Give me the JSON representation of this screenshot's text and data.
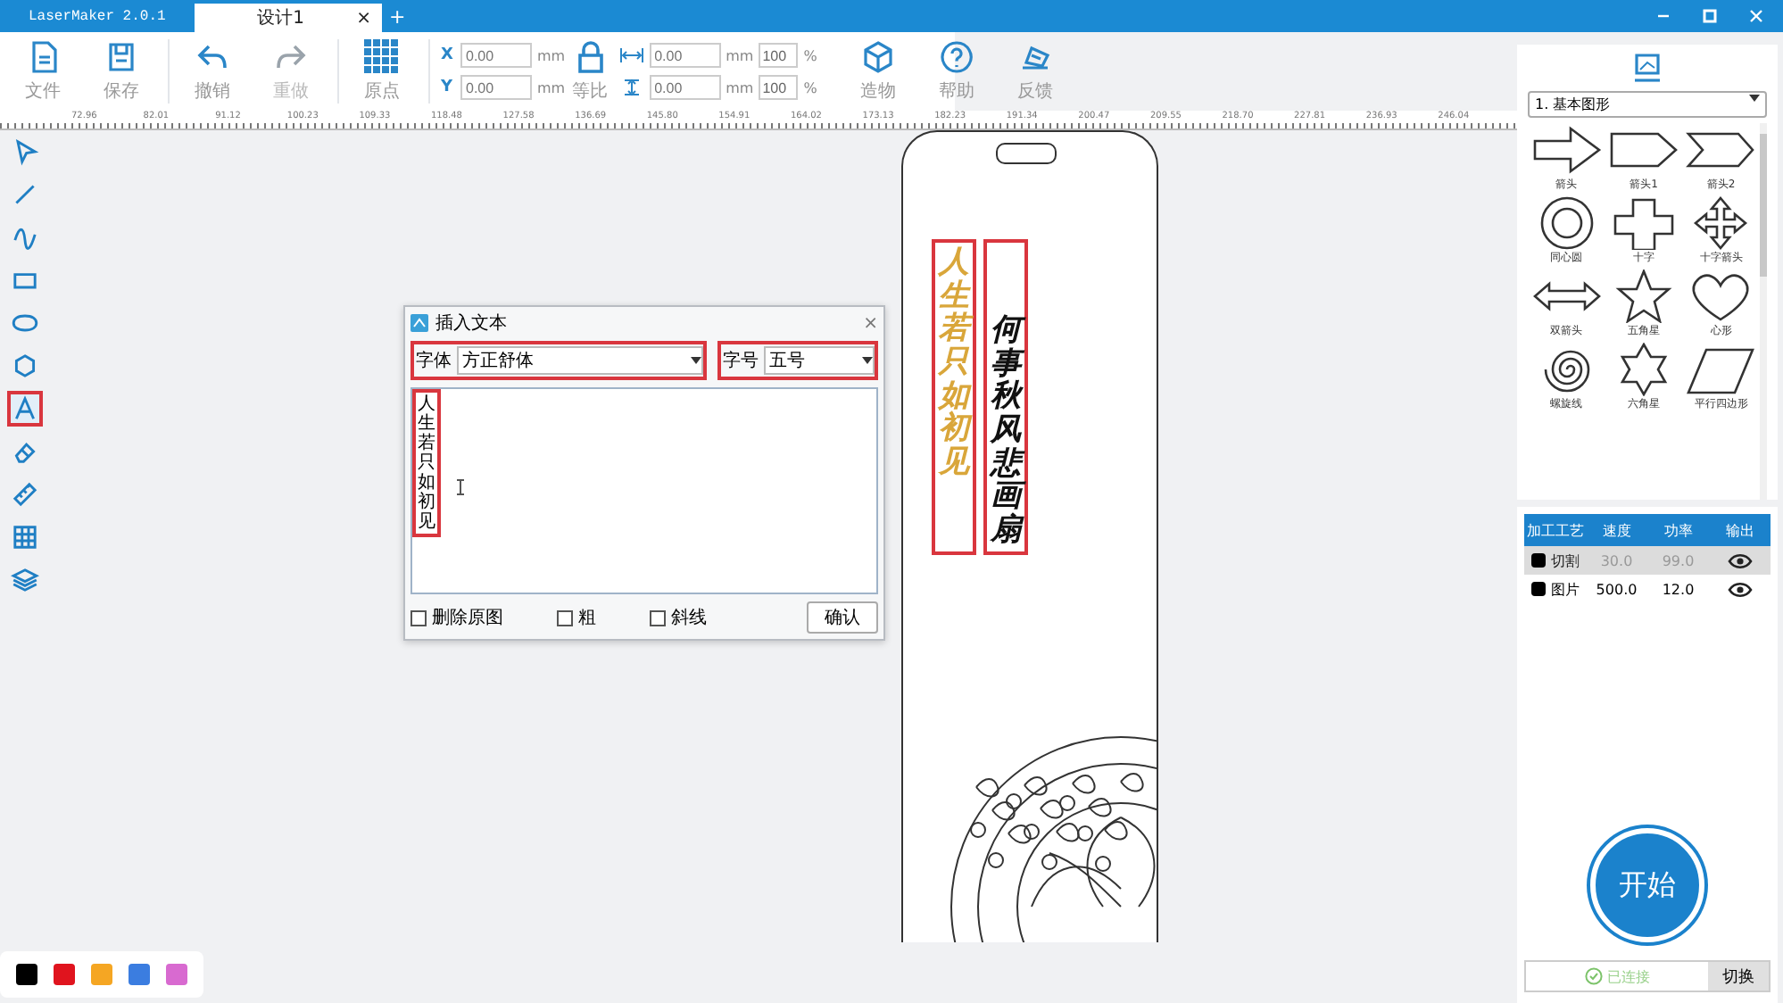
{
  "window": {
    "app_title": "LaserMaker 2.0.1",
    "tabs": [
      {
        "label": "设计1",
        "selected": true,
        "close": "×"
      }
    ],
    "new_tab": "+"
  },
  "toolbar": {
    "file_buttons": [
      {
        "label": "文件"
      },
      {
        "label": "保存"
      }
    ],
    "edit_buttons": [
      {
        "label": "撤销",
        "disabled": false
      },
      {
        "label": "重做",
        "disabled": true
      }
    ],
    "origin_button": "原点",
    "position": [
      {
        "axis": "X",
        "placeholder": "0.00",
        "unit": "mm"
      },
      {
        "axis": "Y",
        "placeholder": "0.00",
        "unit": "mm"
      }
    ],
    "lock_button": "等比",
    "size": [
      {
        "placeholder": "0.00",
        "unit": "mm",
        "percent": "100",
        "percent_unit": "%"
      },
      {
        "placeholder": "0.00",
        "unit": "mm",
        "percent": "100",
        "percent_unit": "%"
      }
    ],
    "help_buttons": [
      {
        "label": "造物"
      },
      {
        "label": "帮助"
      },
      {
        "label": "反馈"
      }
    ]
  },
  "ruler": {
    "labels": [
      "72.96",
      "82.01",
      "91.12",
      "100.23",
      "109.33",
      "118.48",
      "127.58",
      "136.69",
      "145.80",
      "154.91",
      "164.02",
      "173.13",
      "182.23",
      "191.34",
      "200.47",
      "209.55",
      "218.70",
      "227.81",
      "236.93",
      "246.04"
    ]
  },
  "tools": [
    {
      "selected": false,
      "highlighted": false
    },
    {
      "selected": false,
      "highlighted": false
    },
    {
      "selected": false,
      "highlighted": false
    },
    {
      "selected": false,
      "highlighted": false
    },
    {
      "selected": false,
      "highlighted": false
    },
    {
      "selected": false,
      "highlighted": false
    },
    {
      "selected": true,
      "highlighted": true
    },
    {
      "selected": false,
      "highlighted": false
    },
    {
      "selected": false,
      "highlighted": false
    },
    {
      "selected": false,
      "highlighted": false
    },
    {
      "selected": false,
      "highlighted": false
    }
  ],
  "canvas": {
    "texts": [
      {
        "text": "人生若只如初见",
        "color": "#d9a63a",
        "highlighted": true
      },
      {
        "text": "何事秋风悲画扇",
        "color": "#111111",
        "highlighted": true
      }
    ]
  },
  "dialog": {
    "title": "插入文本",
    "close": "×",
    "font": {
      "label": "字体",
      "value": "方正舒体",
      "highlighted": true
    },
    "size": {
      "label": "字号",
      "value": "五号",
      "highlighted": true
    },
    "text": {
      "value": "人生若只如初见",
      "highlighted": true
    },
    "options": [
      {
        "label": "删除原图",
        "checked": false
      },
      {
        "label": "粗",
        "checked": false
      },
      {
        "label": "斜线",
        "checked": false
      }
    ],
    "confirm_button": "确认"
  },
  "palette": [
    {
      "color": "#000000"
    },
    {
      "color": "#e0141e"
    },
    {
      "color": "#f5a623"
    },
    {
      "color": "#3b7de0"
    },
    {
      "color": "#d86ad0"
    }
  ],
  "shapes_panel": {
    "category": "1. 基本图形",
    "shapes": [
      {
        "label": "箭头"
      },
      {
        "label": "箭头1"
      },
      {
        "label": "箭头2"
      },
      {
        "label": "同心圆"
      },
      {
        "label": "十字"
      },
      {
        "label": "十字箭头"
      },
      {
        "label": "双箭头"
      },
      {
        "label": "五角星"
      },
      {
        "label": "心形"
      },
      {
        "label": "螺旋线"
      },
      {
        "label": "六角星"
      },
      {
        "label": "平行四边形"
      }
    ]
  },
  "process_table": {
    "columns": [
      "加工工艺",
      "速度",
      "功率",
      "输出"
    ],
    "rows": [
      {
        "name": "切割",
        "color": "#000000",
        "speed": "30.0",
        "power": "99.0",
        "selected": true
      },
      {
        "name": "图片",
        "color": "#000000",
        "speed": "500.0",
        "power": "12.0",
        "selected": false
      }
    ]
  },
  "start_button": "开始",
  "connection": {
    "status": "已连接",
    "switch_button": "切换"
  }
}
